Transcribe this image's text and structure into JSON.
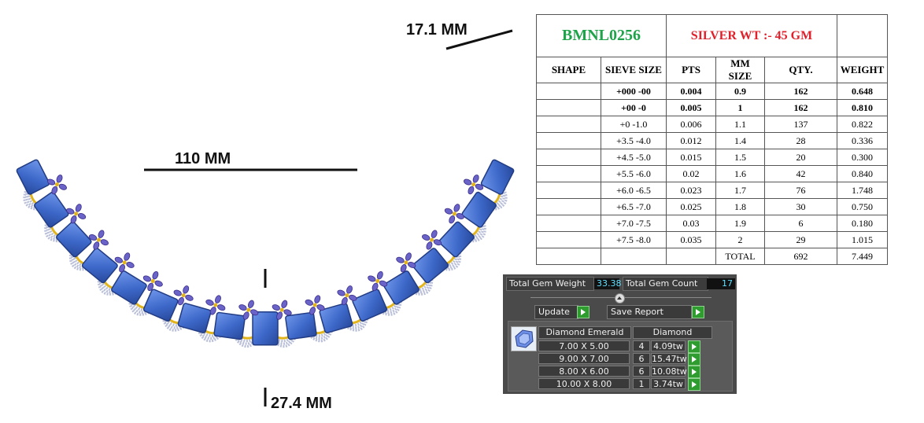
{
  "dimensions": {
    "top_width": "17.1 MM",
    "span": "110 MM",
    "drop": "27.4 MM"
  },
  "spec_table": {
    "design_code": "BMNL0256",
    "silver_weight": "SILVER WT :- 45 GM",
    "headers": [
      "SHAPE",
      "SIEVE SIZE",
      "PTS",
      "MM SIZE",
      "QTY.",
      "WEIGHT"
    ],
    "rows": [
      {
        "shape": "",
        "sieve": "+000 -00",
        "pts": "0.004",
        "mm": "0.9",
        "qty": "162",
        "weight": "0.648"
      },
      {
        "shape": "",
        "sieve": "+00 -0",
        "pts": "0.005",
        "mm": "1",
        "qty": "162",
        "weight": "0.810"
      },
      {
        "shape": "",
        "sieve": "+0 -1.0",
        "pts": "0.006",
        "mm": "1.1",
        "qty": "137",
        "weight": "0.822"
      },
      {
        "shape": "",
        "sieve": "+3.5 -4.0",
        "pts": "0.012",
        "mm": "1.4",
        "qty": "28",
        "weight": "0.336"
      },
      {
        "shape": "",
        "sieve": "+4.5 -5.0",
        "pts": "0.015",
        "mm": "1.5",
        "qty": "20",
        "weight": "0.300"
      },
      {
        "shape": "",
        "sieve": "+5.5 -6.0",
        "pts": "0.02",
        "mm": "1.6",
        "qty": "42",
        "weight": "0.840"
      },
      {
        "shape": "",
        "sieve": "+6.0 -6.5",
        "pts": "0.023",
        "mm": "1.7",
        "qty": "76",
        "weight": "1.748"
      },
      {
        "shape": "",
        "sieve": "+6.5 -7.0",
        "pts": "0.025",
        "mm": "1.8",
        "qty": "30",
        "weight": "0.750"
      },
      {
        "shape": "",
        "sieve": "+7.0 -7.5",
        "pts": "0.03",
        "mm": "1.9",
        "qty": "6",
        "weight": "0.180"
      },
      {
        "shape": "",
        "sieve": "+7.5 -8.0",
        "pts": "0.035",
        "mm": "2",
        "qty": "29",
        "weight": "1.015"
      }
    ],
    "total": {
      "label": "TOTAL",
      "qty": "692",
      "weight": "7.449"
    }
  },
  "gem_panel": {
    "total_weight_label": "Total Gem Weight",
    "total_weight_value": "33.38",
    "total_count_label": "Total Gem Count",
    "total_count_value": "17",
    "update_label": "Update",
    "save_report_label": "Save Report",
    "col_shape": "Diamond Emerald",
    "col_material": "Diamond",
    "rows": [
      {
        "size": "7.00 X 5.00",
        "count": "4",
        "weight": "4.09tw"
      },
      {
        "size": "9.00 X 7.00",
        "count": "6",
        "weight": "15.47tw"
      },
      {
        "size": "8.00 X 6.00",
        "count": "6",
        "weight": "10.08tw"
      },
      {
        "size": "10.00 X 8.00",
        "count": "1",
        "weight": "3.74tw"
      }
    ]
  },
  "colors": {
    "stone": "#3d68c9",
    "accent_stone": "#6a63c8",
    "gold": "#e2b41c",
    "code_green": "#1ea34a",
    "silver_red": "#e0202b"
  }
}
